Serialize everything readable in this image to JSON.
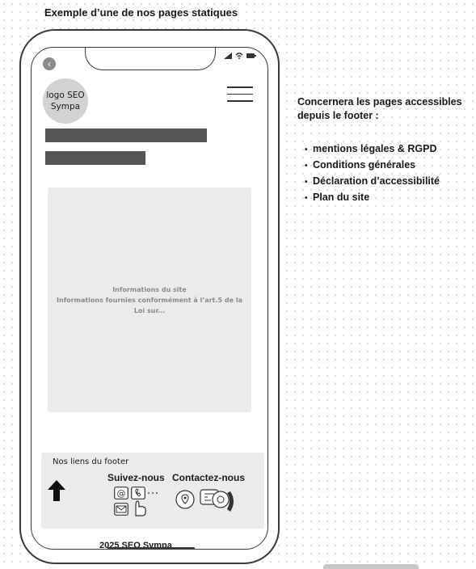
{
  "page_title": "Exemple d’une de nos pages statiques",
  "logo": {
    "line1": "logo SEO",
    "line2": "Sympa"
  },
  "content": {
    "title": "Informations du site",
    "body": "Informations fournies conformément à l’art.5 de la Loi  sur..."
  },
  "footer": {
    "title": "Nos liens du footer",
    "follow_label": "Suivez-nous",
    "contact_label": "Contactez-nous",
    "copyright": "2025 SEO Sympa"
  },
  "note": {
    "heading": "Concernera les pages accessibles depuis le footer :",
    "items": [
      "mentions légales & RGPD",
      "Conditions générales",
      "Déclaration d’accessibilité",
      "Plan du site"
    ]
  }
}
